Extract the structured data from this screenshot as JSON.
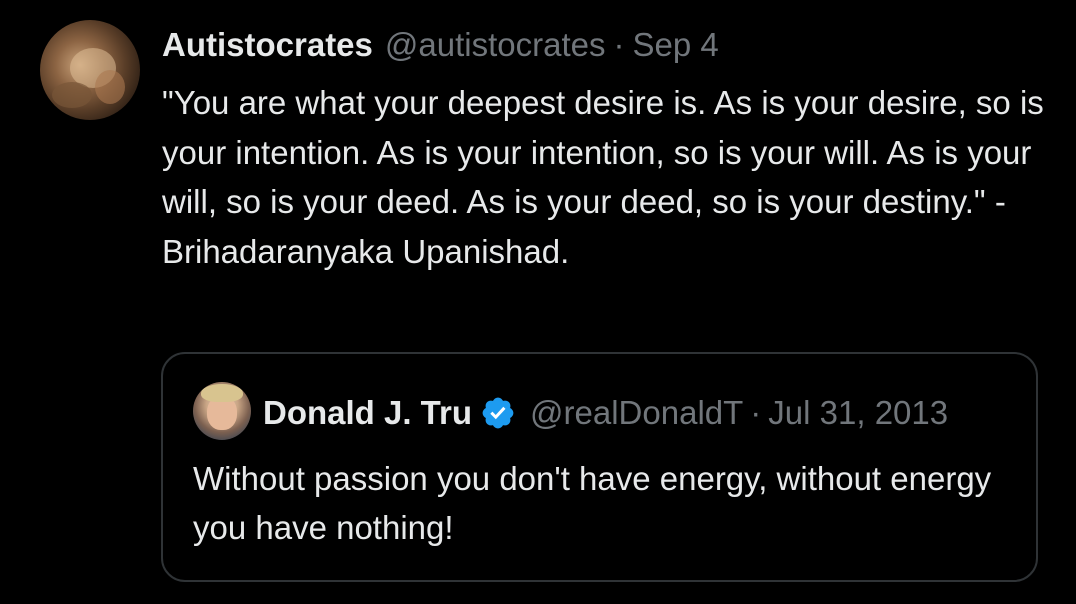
{
  "tweet": {
    "display_name": "Autistocrates",
    "handle": "@autistocrates",
    "separator": "·",
    "date": "Sep 4",
    "text": "\"You are what your deepest desire is. As is your desire, so is your intention. As is your intention, so is your will. As is your will, so is your deed. As is your deed, so is your destiny.\" - Brihadaranyaka Upanishad.",
    "avatar_icon": "profile-photo"
  },
  "quoted_tweet": {
    "display_name": "Donald J. Tru",
    "verified_icon": "verified-badge-icon",
    "handle": "@realDonaldT",
    "separator": "·",
    "date": "Jul 31, 2013",
    "text": "Without passion you don't have energy, without energy you have nothing!",
    "avatar_icon": "profile-photo"
  },
  "colors": {
    "background": "#000000",
    "text_primary": "#e7e9ea",
    "text_secondary": "#71767b",
    "border": "#2f3336",
    "verified_blue": "#1d9bf0"
  }
}
